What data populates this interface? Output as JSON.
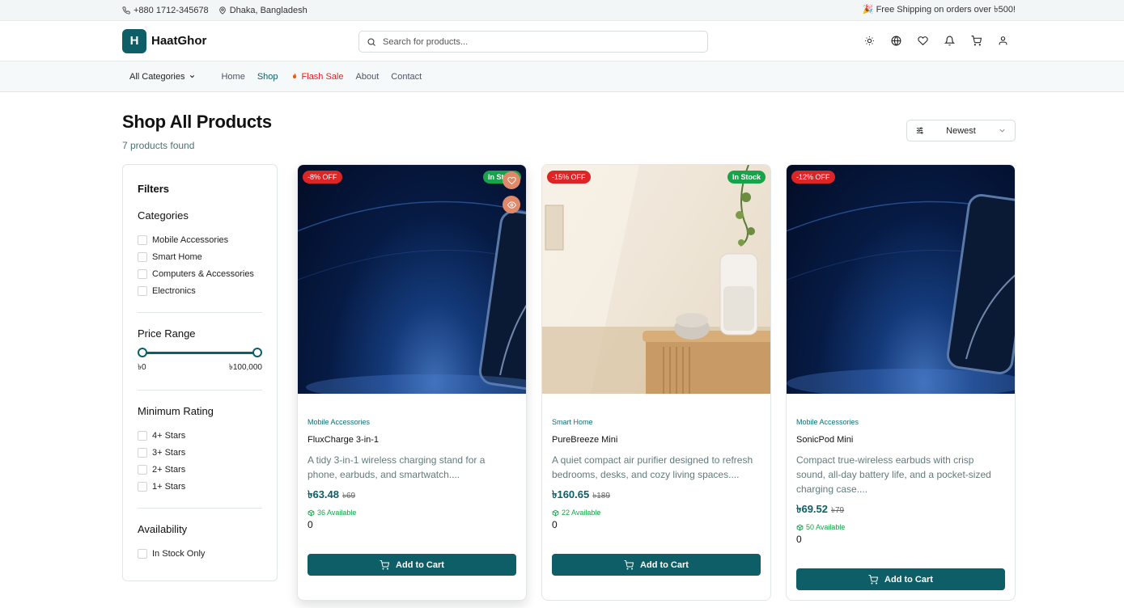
{
  "topbar": {
    "phone": "+880 1712-345678",
    "location": "Dhaka, Bangladesh",
    "promo": "🎉 Free Shipping on orders over ৳500!"
  },
  "header": {
    "logo_letter": "H",
    "brand": "HaatGhor",
    "search_placeholder": "Search for products...",
    "icons": [
      "sun-icon",
      "globe-icon",
      "heart-icon",
      "bell-icon",
      "cart-icon",
      "user-icon"
    ]
  },
  "nav": {
    "categories_label": "All Categories",
    "links": [
      "Home",
      "Shop",
      "Flash Sale",
      "About",
      "Contact"
    ]
  },
  "page": {
    "title": "Shop All Products",
    "count": "7 products found",
    "sort_value": "Newest"
  },
  "filters": {
    "title": "Filters",
    "categories_title": "Categories",
    "categories": [
      "Mobile Accessories",
      "Smart Home",
      "Computers & Accessories",
      "Electronics"
    ],
    "price_title": "Price Range",
    "price_min": "৳0",
    "price_max": "৳100,000",
    "price_range_fraction": [
      0,
      1
    ],
    "rating_title": "Minimum Rating",
    "ratings": [
      "4+ Stars",
      "3+ Stars",
      "2+ Stars",
      "1+ Stars"
    ],
    "availability_title": "Availability",
    "availability_option": "In Stock Only"
  },
  "products": [
    {
      "discount": "-8% OFF",
      "stock": "In Stock",
      "category": "Mobile Accessories",
      "name": "FluxCharge 3-in-1",
      "description": "A tidy 3-in-1 wireless charging stand for a phone, earbuds, and smartwatch....",
      "price": "৳63.48",
      "old_price": "৳69",
      "available": "36 Available",
      "extra": "0",
      "button": "Add to Cart"
    },
    {
      "discount": "-15% OFF",
      "stock": "In Stock",
      "category": "Smart Home",
      "name": "PureBreeze Mini",
      "description": "A quiet compact air purifier designed to refresh bedrooms, desks, and cozy living spaces....",
      "price": "৳160.65",
      "old_price": "৳189",
      "available": "22 Available",
      "extra": "0",
      "button": "Add to Cart"
    },
    {
      "discount": "-12% OFF",
      "stock": "",
      "category": "Mobile Accessories",
      "name": "SonicPod Mini",
      "description": "Compact true-wireless earbuds with crisp sound, all-day battery life, and a pocket-sized charging case....",
      "price": "৳69.52",
      "old_price": "৳79",
      "available": "50 Available",
      "extra": "0",
      "button": "Add to Cart"
    }
  ],
  "colors": {
    "brand": "#0e5e67",
    "sale": "#dc2626",
    "stock": "#16a34a"
  }
}
